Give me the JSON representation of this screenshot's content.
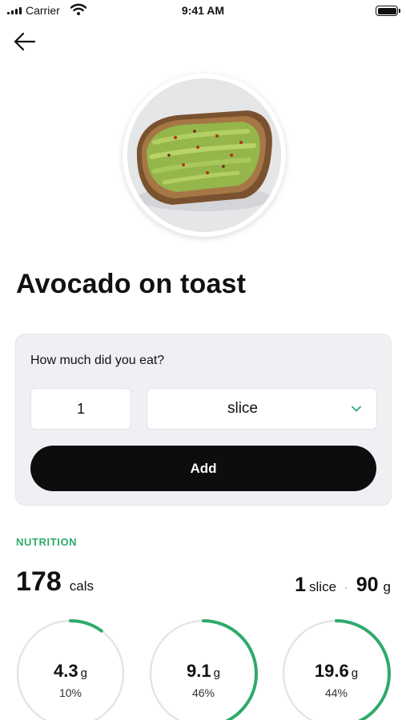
{
  "status_bar": {
    "carrier": "Carrier",
    "time": "9:41 AM"
  },
  "food": {
    "title": "Avocado on toast"
  },
  "portion": {
    "question": "How much did you eat?",
    "quantity": "1",
    "unit": "slice",
    "add_label": "Add"
  },
  "nutrition": {
    "heading": "NUTRITION",
    "calories": "178",
    "calories_unit": "cals",
    "serving_count": "1",
    "serving_unit": "slice",
    "separator": "·",
    "serving_weight": "90",
    "serving_weight_unit": "g",
    "macros": [
      {
        "amount": "4.3",
        "unit": "g",
        "percent_label": "10%",
        "percent": 10
      },
      {
        "amount": "9.1",
        "unit": "g",
        "percent_label": "46%",
        "percent": 46
      },
      {
        "amount": "19.6",
        "unit": "g",
        "percent_label": "44%",
        "percent": 44
      }
    ]
  },
  "colors": {
    "accent": "#2faa6b",
    "ring_track": "#e3e5e8",
    "button": "#0d0d0d",
    "card": "#eef0f3"
  },
  "icons": {
    "back": "arrow-left-icon",
    "dropdown": "chevron-down-icon",
    "wifi": "wifi-icon",
    "battery": "battery-icon",
    "signal": "signal-icon"
  }
}
